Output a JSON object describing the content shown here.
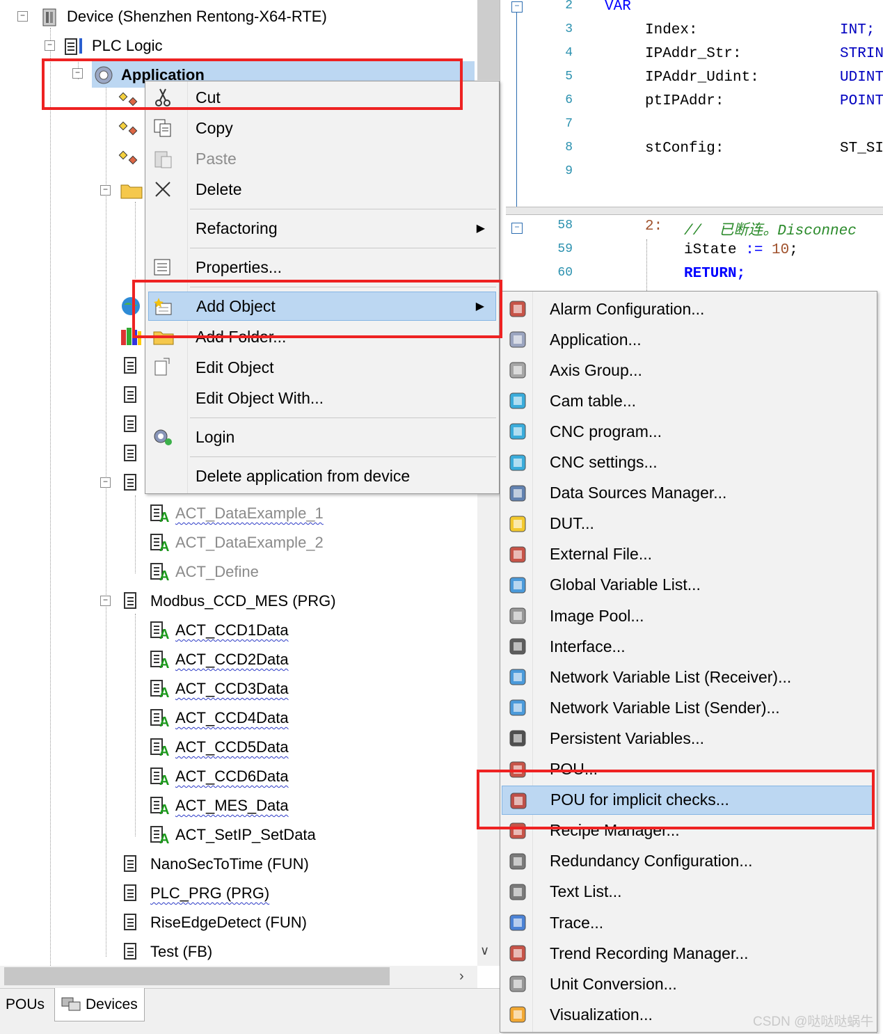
{
  "tree": {
    "device": "Device (Shenzhen Rentong-X64-RTE)",
    "plc_logic": "PLC Logic",
    "application": "Application",
    "act_items_gray": [
      "ACT_DataExample_1",
      "ACT_DataExample_2",
      "ACT_Define"
    ],
    "modbus": "Modbus_CCD_MES (PRG)",
    "modbus_actions": [
      "ACT_CCD1Data",
      "ACT_CCD2Data",
      "ACT_CCD3Data",
      "ACT_CCD4Data",
      "ACT_CCD5Data",
      "ACT_CCD6Data",
      "ACT_MES_Data",
      "ACT_SetIP_SetData"
    ],
    "pous": [
      "NanoSecToTime (FUN)",
      "PLC_PRG (PRG)",
      "RiseEdgeDetect (FUN)",
      "Test (FB)"
    ]
  },
  "tabs": {
    "pous": "POUs",
    "devices": "Devices"
  },
  "code": {
    "lines_top": [
      {
        "n": "2",
        "text": "VAR"
      },
      {
        "n": "3",
        "name": "Index:",
        "type": "INT;"
      },
      {
        "n": "4",
        "name": "IPAddr_Str:",
        "type": "STRIN"
      },
      {
        "n": "5",
        "name": "IPAddr_Udint:",
        "type": "UDINT"
      },
      {
        "n": "6",
        "name": "ptIPAddr:",
        "type": "POINT"
      },
      {
        "n": "7"
      },
      {
        "n": "8",
        "name": "stConfig:",
        "type": "ST_SI"
      },
      {
        "n": "9"
      }
    ],
    "lines_bottom": [
      {
        "n": "58",
        "case": "2:",
        "comment": "//  已断连。Disconnec"
      },
      {
        "n": "59",
        "stmt": "iState := 10;"
      },
      {
        "n": "60",
        "stmt": "RETURN;"
      }
    ]
  },
  "context_menu": {
    "cut": "Cut",
    "copy": "Copy",
    "paste": "Paste",
    "delete": "Delete",
    "refactoring": "Refactoring",
    "properties": "Properties...",
    "add_object": "Add Object",
    "add_folder": "Add Folder...",
    "edit_object": "Edit Object",
    "edit_object_with": "Edit Object With...",
    "login": "Login",
    "delete_app": "Delete application from device"
  },
  "submenu": [
    "Alarm Configuration...",
    "Application...",
    "Axis Group...",
    "Cam table...",
    "CNC program...",
    "CNC settings...",
    "Data Sources Manager...",
    "DUT...",
    "External File...",
    "Global Variable List...",
    "Image Pool...",
    "Interface...",
    "Network Variable List (Receiver)...",
    "Network Variable List (Sender)...",
    "Persistent Variables...",
    "POU...",
    "POU for implicit checks...",
    "Recipe Manager...",
    "Redundancy Configuration...",
    "Text List...",
    "Trace...",
    "Trend Recording Manager...",
    "Unit Conversion...",
    "Visualization..."
  ],
  "watermark": "CSDN @哒哒哒蜗牛",
  "colors": {
    "highlight": "#bcd7f2",
    "annotation_red": "#ee2222",
    "keyword": "#0000ff"
  }
}
